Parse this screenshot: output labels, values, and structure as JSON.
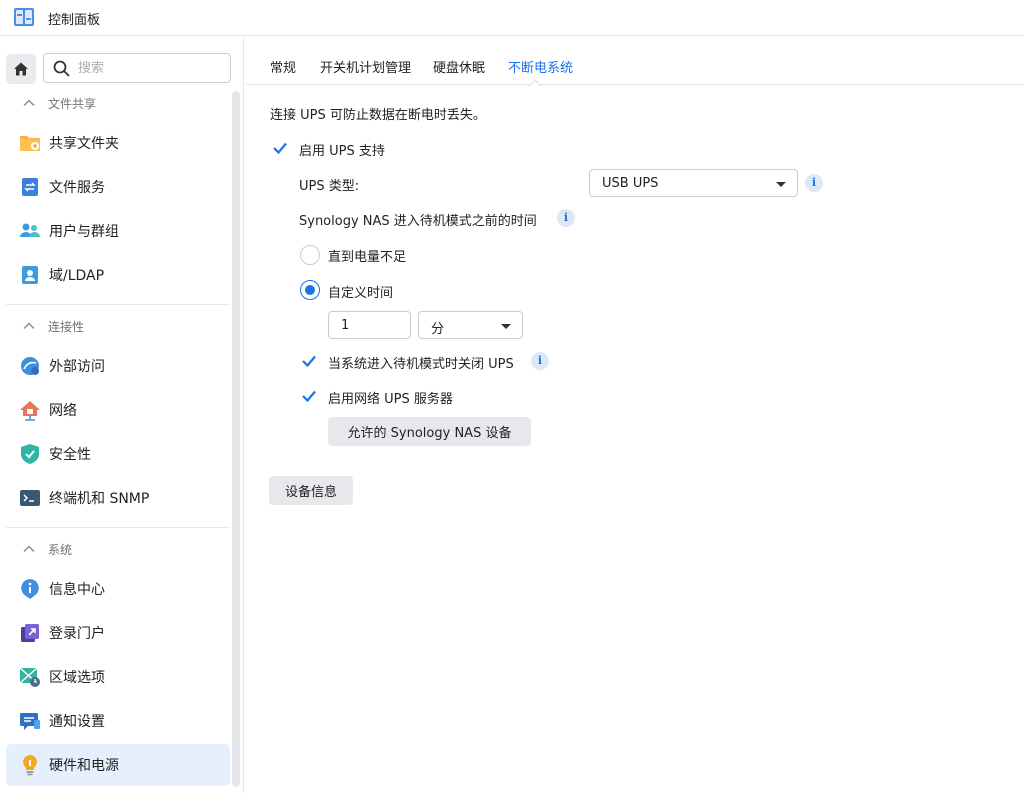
{
  "window": {
    "title": "控制面板"
  },
  "sidebar": {
    "search_placeholder": "搜索",
    "sections": [
      {
        "title": "文件共享",
        "items": [
          "共享文件夹",
          "文件服务",
          "用户与群组",
          "域/LDAP"
        ]
      },
      {
        "title": "连接性",
        "items": [
          "外部访问",
          "网络",
          "安全性",
          "终端机和 SNMP"
        ]
      },
      {
        "title": "系统",
        "items": [
          "信息中心",
          "登录门户",
          "区域选项",
          "通知设置",
          "硬件和电源"
        ]
      }
    ],
    "active_item": "硬件和电源"
  },
  "tabs": [
    {
      "label": "常规",
      "active": false
    },
    {
      "label": "开关机计划管理",
      "active": false
    },
    {
      "label": "硬盘休眠",
      "active": false
    },
    {
      "label": "不断电系统",
      "active": true
    }
  ],
  "ups": {
    "description": "连接 UPS 可防止数据在断电时丢失。",
    "enable_label": "启用 UPS 支持",
    "enable_checked": true,
    "type_label": "UPS 类型:",
    "type_value": "USB UPS",
    "standby_label": "Synology NAS 进入待机模式之前的时间",
    "option_low_battery": "直到电量不足",
    "option_custom": "自定义时间",
    "selected_option": "自定义时间",
    "time_value": "1",
    "time_unit": "分",
    "shutdown_label": "当系统进入待机模式时关闭 UPS",
    "shutdown_checked": true,
    "network_server_label": "启用网络 UPS 服务器",
    "network_server_checked": true,
    "allowed_devices_button": "允许的 Synology NAS 设备",
    "device_info_button": "设备信息"
  },
  "colors": {
    "accent": "#1a73e8",
    "active_bg": "#e6f0fc"
  }
}
